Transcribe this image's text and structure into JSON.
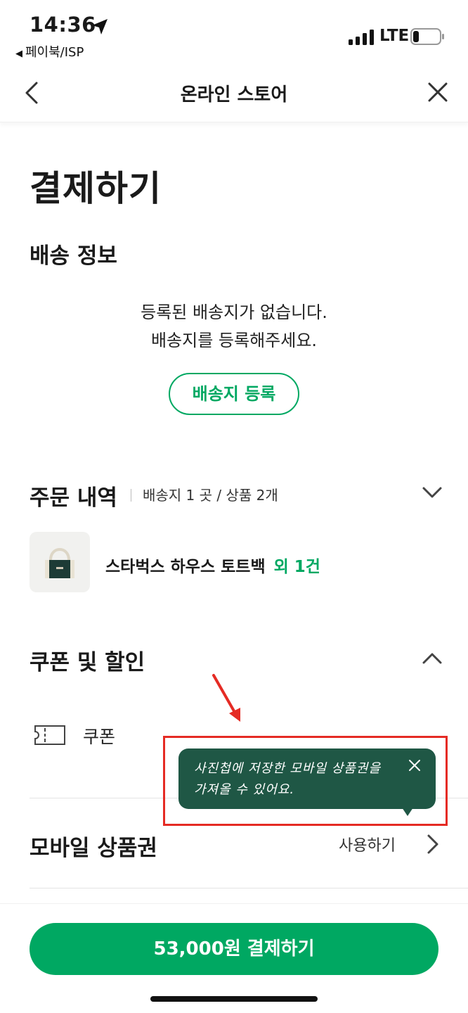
{
  "status_bar": {
    "time": "14:36",
    "back_app": "페이북/ISP",
    "network": "LTE"
  },
  "nav": {
    "title": "온라인 스토어"
  },
  "page_title": "결제하기",
  "shipping": {
    "title": "배송 정보",
    "empty_line1": "등록된 배송지가 없습니다.",
    "empty_line2": "배송지를 등록해주세요.",
    "register_button": "배송지 등록"
  },
  "order": {
    "title": "주문 내역",
    "meta": "배송지 1 곳 / 상품 2개",
    "product_name": "스타벅스 하우스 토트백",
    "product_extra": "외 1건"
  },
  "discount": {
    "title": "쿠폰 및 할인",
    "coupon_label": "쿠폰"
  },
  "mobile_voucher": {
    "title": "모바일 상품권",
    "use_label": "사용하기"
  },
  "tooltip": {
    "line1": "사진첩에 저장한 모바일 상품권을",
    "line2": "가져올 수 있어요."
  },
  "pay_button": "53,000원 결제하기",
  "colors": {
    "brand_green": "#00a862",
    "tooltip_bg": "#1f5745",
    "highlight_red": "#e52b24"
  }
}
